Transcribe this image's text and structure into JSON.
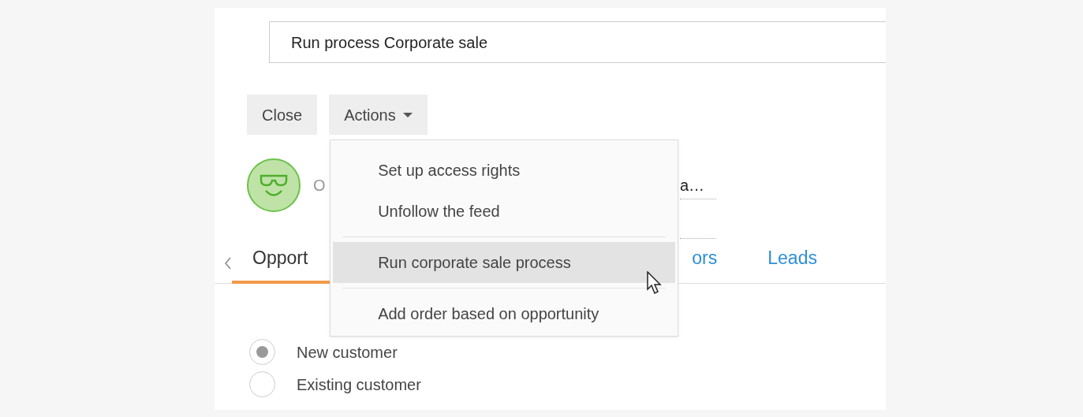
{
  "title_field": {
    "value": "Run process Corporate sale"
  },
  "buttons": [
    {
      "label": "Close",
      "kind": "plain"
    },
    {
      "label": "Actions",
      "kind": "dropdown"
    }
  ],
  "actions_menu": [
    {
      "kind": "item",
      "label": "Set up access rights",
      "selected": false
    },
    {
      "kind": "item",
      "label": "Unfollow the feed",
      "selected": false
    },
    {
      "kind": "divider"
    },
    {
      "kind": "item",
      "label": "Run corporate sale process",
      "selected": true
    },
    {
      "kind": "divider"
    },
    {
      "kind": "item",
      "label": "Add order based on opportunity",
      "selected": false
    }
  ],
  "header_fragments": {
    "left": "O",
    "right": "a…"
  },
  "tabs": [
    {
      "label": "Opport",
      "selected": true
    },
    {
      "label": "ors",
      "selected": false
    },
    {
      "label": "Leads",
      "selected": false
    }
  ],
  "customer_type": [
    {
      "label": "New customer",
      "selected": true
    },
    {
      "label": "Existing customer",
      "selected": false
    }
  ]
}
